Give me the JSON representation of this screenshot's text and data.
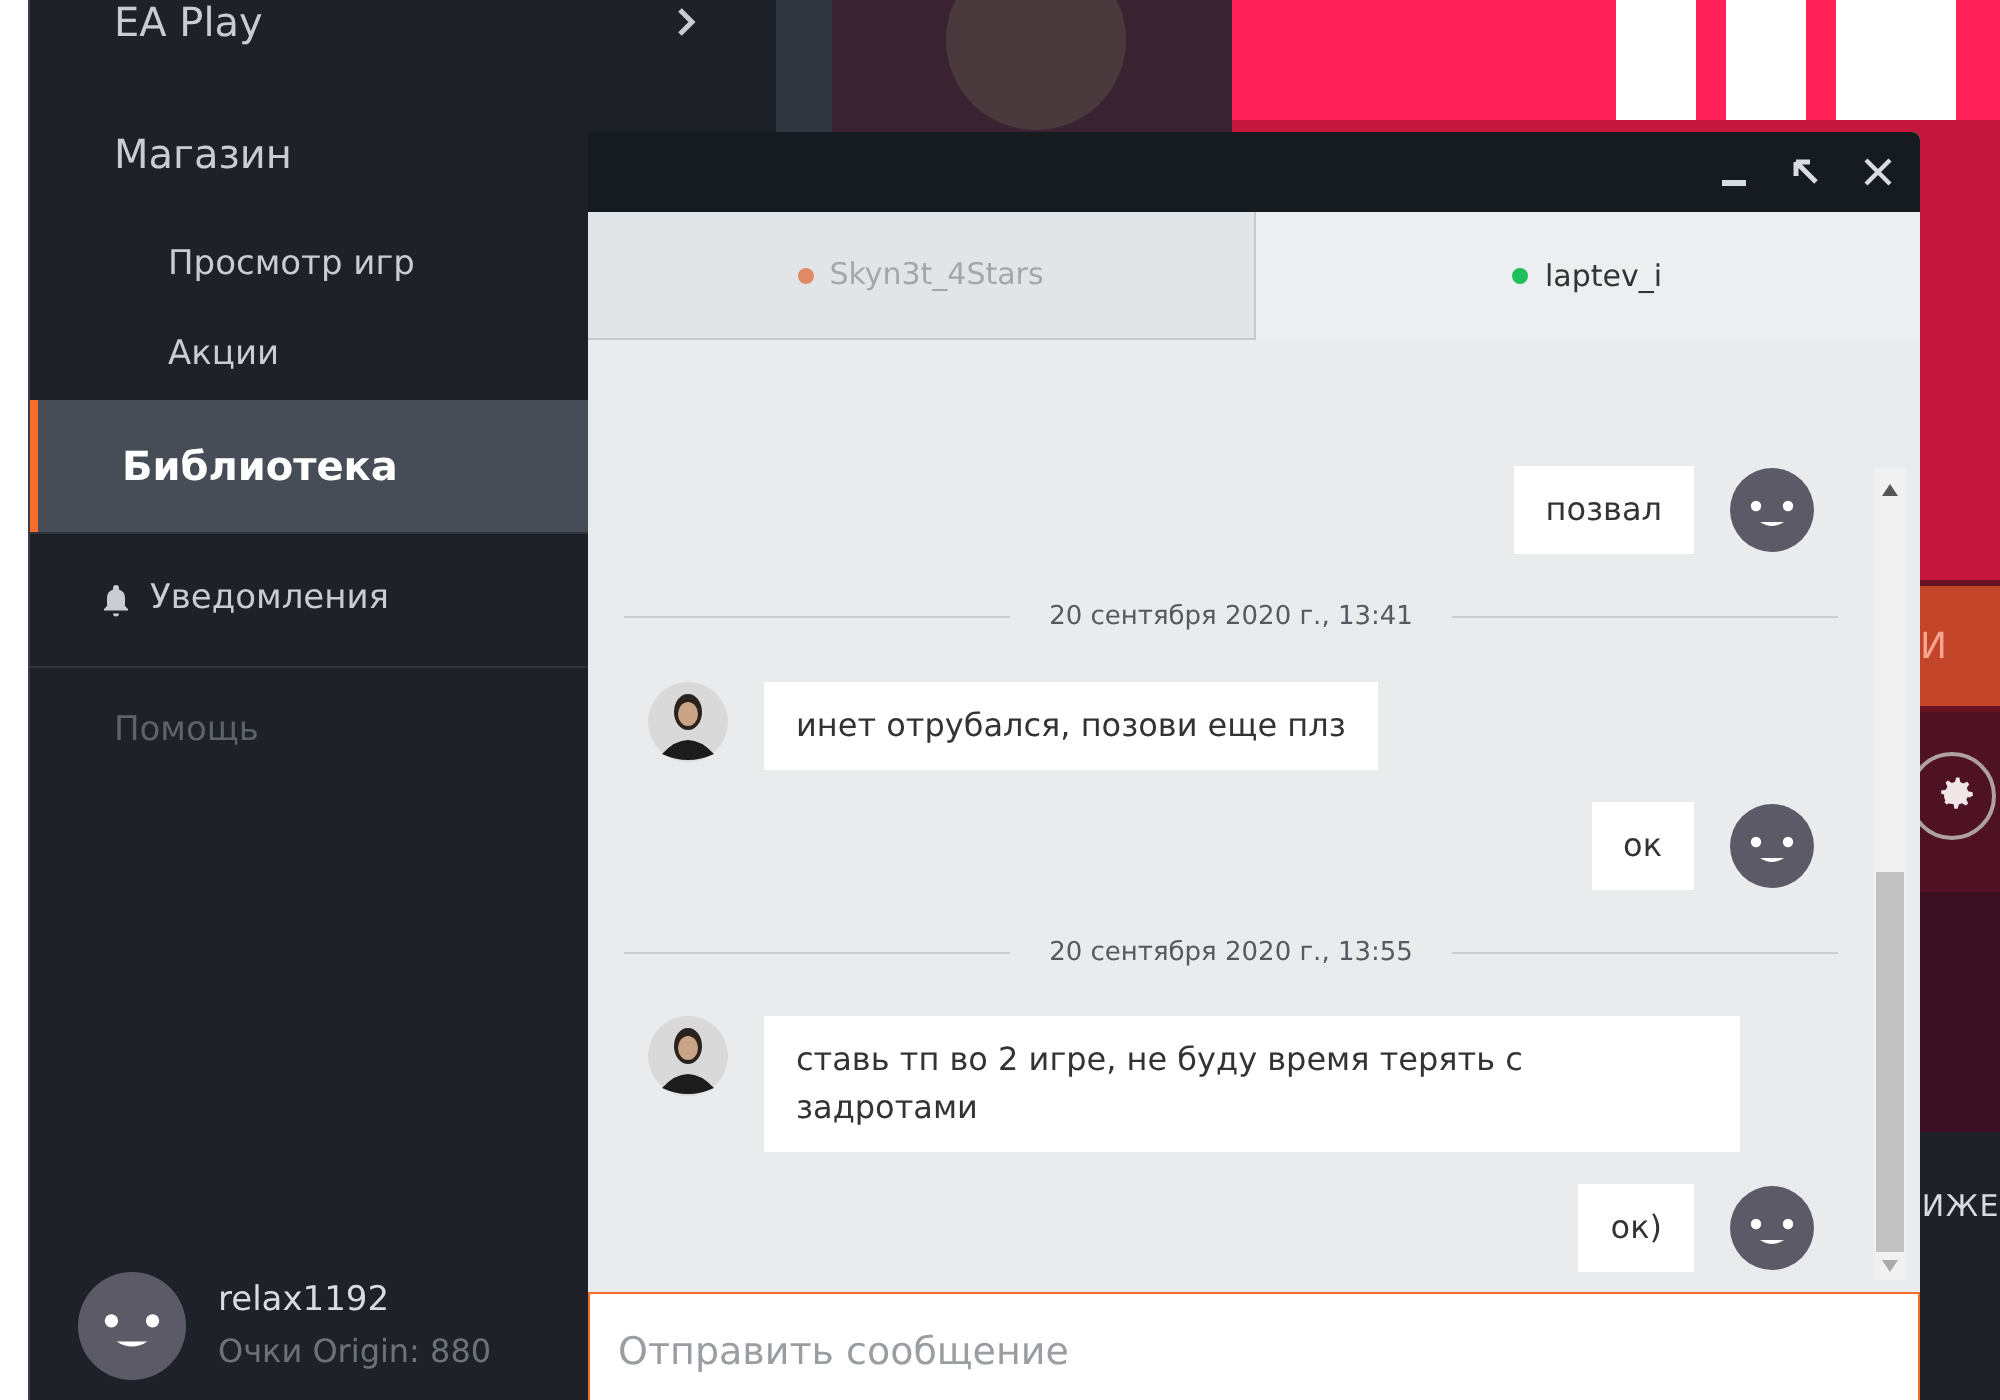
{
  "sidebar": {
    "items": [
      {
        "label": "EA Play",
        "kind": "section",
        "selected": false,
        "has_chevron": true
      },
      {
        "label": "Магазин",
        "kind": "section",
        "selected": false
      },
      {
        "label": "Просмотр игр",
        "kind": "subitem",
        "selected": false
      },
      {
        "label": "Акции",
        "kind": "subitem",
        "selected": false
      },
      {
        "label": "Библиотека",
        "kind": "section",
        "selected": true
      },
      {
        "label": "Уведомления",
        "kind": "notifications",
        "selected": false
      },
      {
        "label": "Помощь",
        "kind": "muted",
        "selected": false
      }
    ],
    "user": {
      "name": "relax1192",
      "points": "Очки Origin: 880"
    }
  },
  "background": {
    "button_label": "И",
    "bottom_text": "ИЖЕ"
  },
  "chat": {
    "tabs": [
      {
        "name": "Skyn3t_4Stars",
        "color": "#e08a63",
        "selected": false
      },
      {
        "name": "laptev_i",
        "color": "#1fbf5f",
        "selected": true
      }
    ],
    "messages": [
      {
        "kind": "outgoing",
        "text": "позвал"
      },
      {
        "kind": "date",
        "text": "20 сентября 2020 г., 13:41"
      },
      {
        "kind": "incoming",
        "text": "инет отрубался, позови еще плз"
      },
      {
        "kind": "outgoing",
        "text": "ок"
      },
      {
        "kind": "date",
        "text": "20 сентября 2020 г., 13:55"
      },
      {
        "kind": "incoming",
        "text": "ставь тп во 2 игре, не буду время терять с задротами"
      },
      {
        "kind": "outgoing",
        "text": "ок)"
      }
    ],
    "input": {
      "placeholder": "Отправить сообщение"
    }
  }
}
